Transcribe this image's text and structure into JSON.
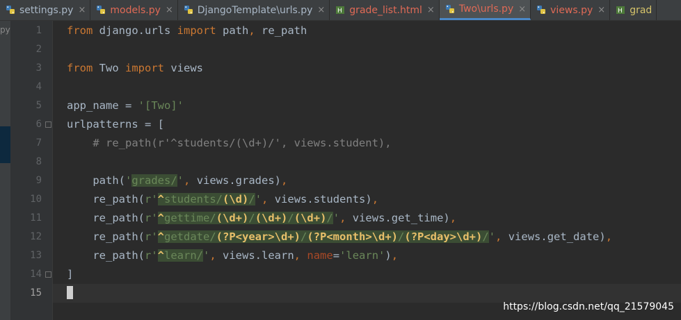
{
  "tabs": [
    {
      "label": "settings.py",
      "icon": "python-file-icon",
      "color": "#a9b7c6",
      "active": false
    },
    {
      "label": "models.py",
      "icon": "python-file-icon",
      "color": "#e06a56",
      "active": false
    },
    {
      "label": "DjangoTemplate\\urls.py",
      "icon": "python-file-icon",
      "color": "#a9b7c6",
      "active": false
    },
    {
      "label": "grade_list.html",
      "icon": "html-file-icon",
      "color": "#e06a56",
      "active": false
    },
    {
      "label": "Two\\urls.py",
      "icon": "python-file-icon",
      "color": "#e06a56",
      "active": true
    },
    {
      "label": "views.py",
      "icon": "python-file-icon",
      "color": "#e06a56",
      "active": false
    },
    {
      "label": "grad",
      "icon": "html-file-icon",
      "color": "#d5c36a",
      "active": false
    }
  ],
  "left_panel": {
    "text": "py"
  },
  "code": {
    "line_numbers": [
      "1",
      "2",
      "3",
      "4",
      "5",
      "6",
      "7",
      "8",
      "9",
      "10",
      "11",
      "12",
      "13",
      "14",
      "15"
    ],
    "current_line": 15,
    "lines": [
      "from django.urls import path, re_path",
      "",
      "from Two import views",
      "",
      "app_name = '[Two]'",
      "urlpatterns = [",
      "    # re_path(r'^students/(\\d+)/', views.student),",
      "",
      "    path('grades/', views.grades),",
      "    re_path(r'^students/(\\d)/', views.students),",
      "    re_path(r'^gettime/(\\d+)/(\\d+)/(\\d+)/', views.get_time),",
      "    re_path(r'^getdate/(?P<year>\\d+)/(?P<month>\\d+)/(?P<day>\\d+)/', views.get_date),",
      "    re_path(r'^learn/', views.learn, name='learn'),",
      "]",
      ""
    ]
  },
  "watermark": "https://blog.csdn.net/qq_21579045",
  "colors": {
    "background": "#2b2b2b",
    "keyword": "#cc7832",
    "string": "#6a8759",
    "regex_escape": "#e8bf6a",
    "comment": "#808080",
    "active_tab_underline": "#4a88c7"
  }
}
